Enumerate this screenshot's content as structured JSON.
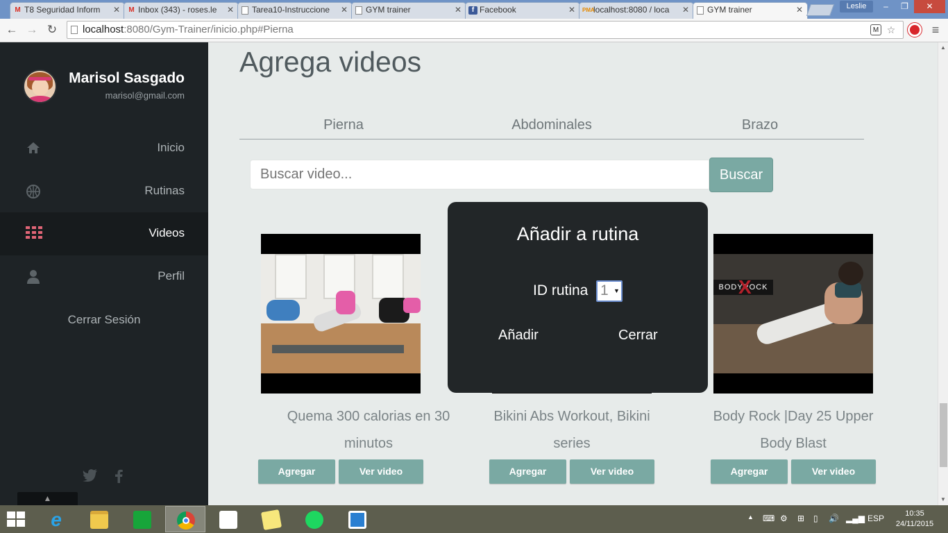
{
  "browser": {
    "tabs": [
      {
        "title": "T8 Seguridad Inform",
        "favicon": "gmail-icon"
      },
      {
        "title": "Inbox (343) - roses.le",
        "favicon": "gmail-icon"
      },
      {
        "title": "Tarea10-Instruccione",
        "favicon": "page-icon"
      },
      {
        "title": "GYM trainer",
        "favicon": "page-icon"
      },
      {
        "title": "Facebook",
        "favicon": "facebook-icon"
      },
      {
        "title": "localhost:8080 / loca",
        "favicon": "phpmyadmin-icon"
      },
      {
        "title": "GYM trainer",
        "favicon": "page-icon",
        "active": true
      }
    ],
    "profile_name": "Leslie",
    "url_host": "localhost",
    "url_path": ":8080/Gym-Trainer/inicio.php#Pierna"
  },
  "sidebar": {
    "user_name": "Marisol Sasgado",
    "user_email": "marisol@gmail.com",
    "items": [
      {
        "label": "Inicio",
        "icon": "home-icon"
      },
      {
        "label": "Rutinas",
        "icon": "basketball-icon"
      },
      {
        "label": "Videos",
        "icon": "grid-icon",
        "active": true
      },
      {
        "label": "Perfil",
        "icon": "user-icon"
      }
    ],
    "logout_label": "Cerrar Sesión",
    "accent_color": "#e06576"
  },
  "main": {
    "title": "Agrega videos",
    "tabs": [
      "Pierna",
      "Abdominales",
      "Brazo"
    ],
    "search": {
      "placeholder": "Buscar video...",
      "button_label": "Buscar"
    },
    "videos": [
      {
        "title_line1": "Quema 300 calorias en 30",
        "title_line2": "minutos",
        "add_label": "Agregar",
        "view_label": "Ver video"
      },
      {
        "title_line1": "Bikini Abs Workout, Bikini",
        "title_line2": "series",
        "add_label": "Agregar",
        "view_label": "Ver video"
      },
      {
        "title_line1": "Body Rock |Day 25 Upper",
        "title_line2": "Body Blast",
        "add_label": "Agregar",
        "view_label": "Ver video",
        "logo_text": "BODYROCK"
      }
    ],
    "button_color": "#7aa9a3"
  },
  "modal": {
    "title": "Añadir a rutina",
    "select_label": "ID rutina",
    "select_value": "1",
    "add_label": "Añadir",
    "close_label": "Cerrar"
  },
  "taskbar": {
    "language": "ESP",
    "time": "10:35",
    "date": "24/11/2015"
  }
}
